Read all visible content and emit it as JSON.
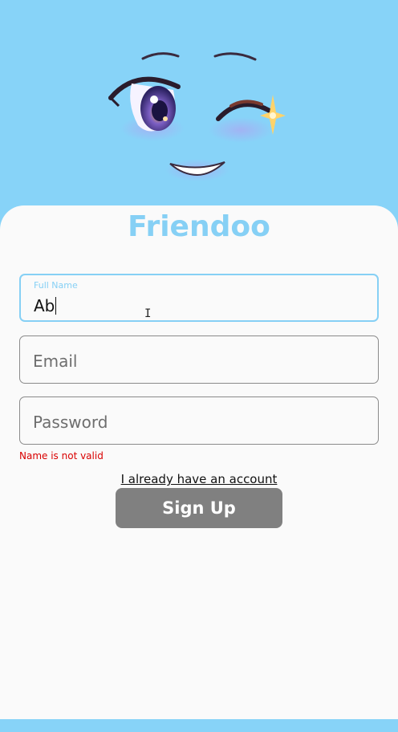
{
  "app": {
    "title": "Friendoo"
  },
  "form": {
    "full_name": {
      "label": "Full Name",
      "value": "Ab"
    },
    "email": {
      "placeholder": "Email"
    },
    "password": {
      "placeholder": "Password"
    },
    "error": "Name is not valid",
    "login_link": "I already have an account",
    "submit_label": "Sign Up"
  },
  "colors": {
    "background": "#87d3f8",
    "accent": "#86d0f5",
    "error": "#d90000",
    "button": "#808080",
    "card": "#fafafa"
  },
  "icons": {
    "mascot": "winking-face-illustration",
    "cursor": "text-cursor-icon"
  }
}
